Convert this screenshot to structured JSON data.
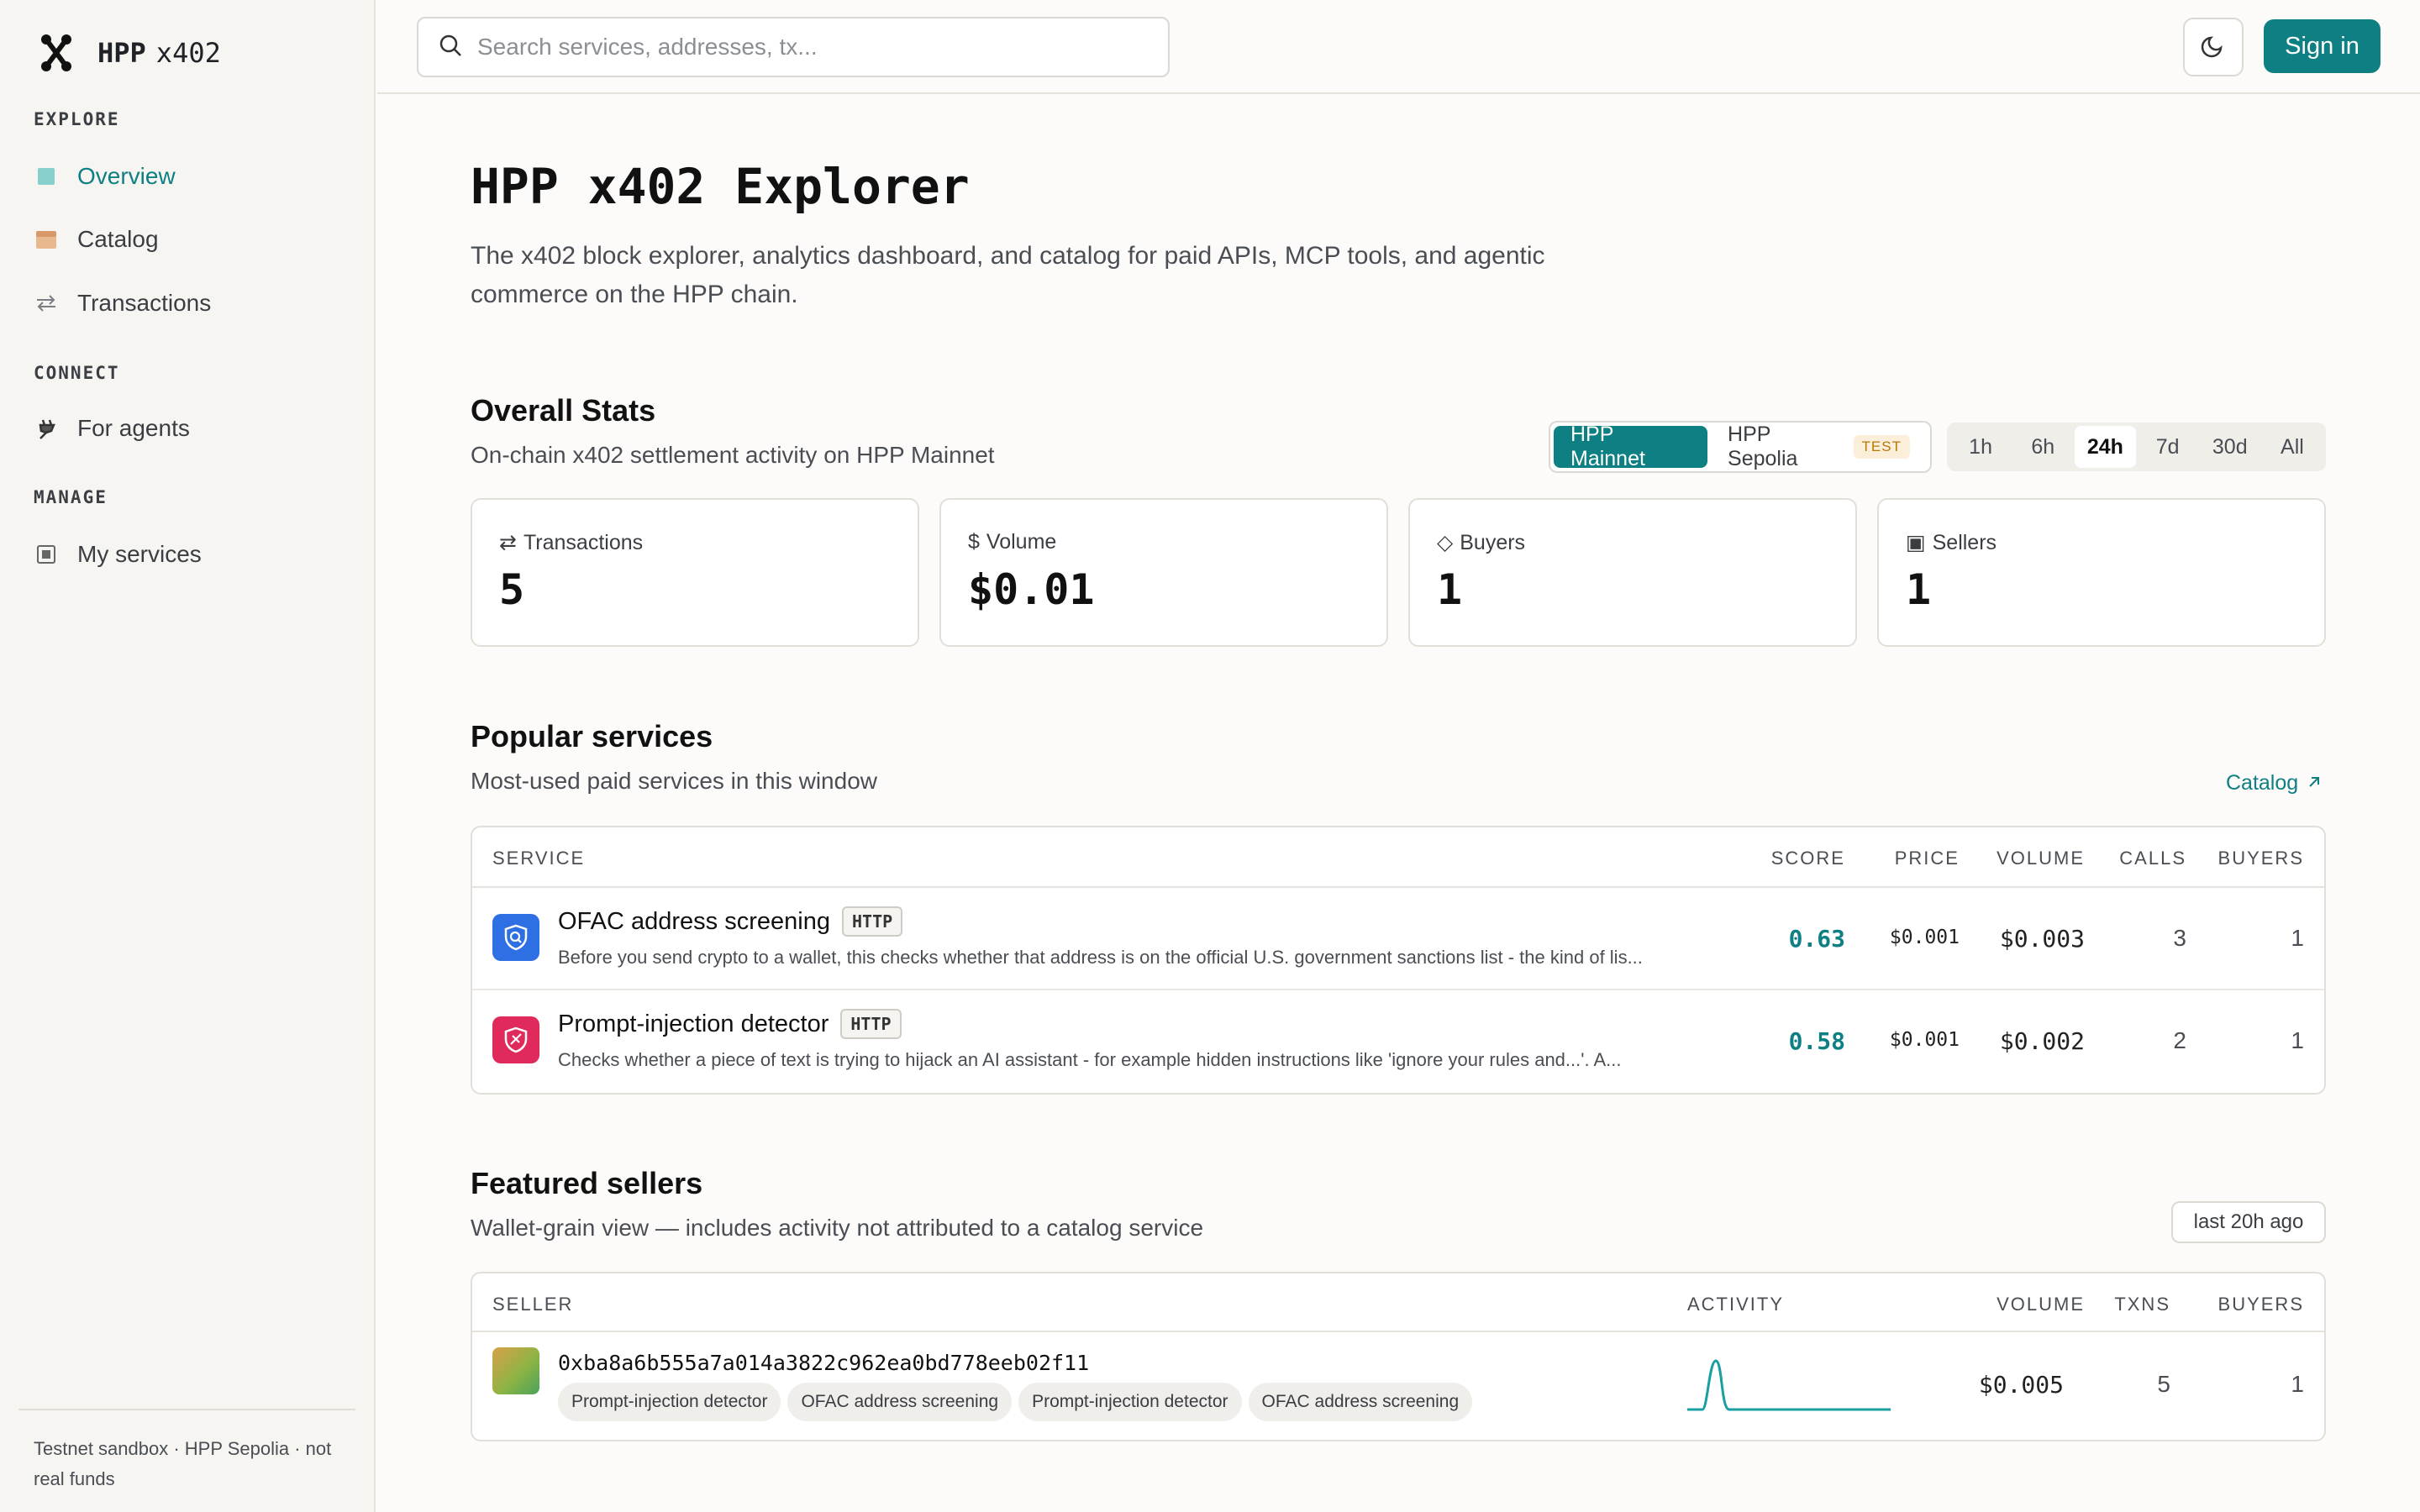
{
  "brand": {
    "name": "HPP",
    "suffix": "x402"
  },
  "sidebar": {
    "sections": [
      {
        "title": "EXPLORE"
      },
      {
        "title": "CONNECT"
      },
      {
        "title": "MANAGE"
      }
    ],
    "items": [
      {
        "label": "Overview",
        "icon": "overview-icon",
        "active": true
      },
      {
        "label": "Catalog",
        "icon": "catalog-icon"
      },
      {
        "label": "Transactions",
        "icon": "transactions-icon"
      },
      {
        "label": "For agents",
        "icon": "plug-icon"
      },
      {
        "label": "My services",
        "icon": "services-icon"
      }
    ],
    "footer": "Testnet sandbox · HPP Sepolia · not real funds"
  },
  "topbar": {
    "search_placeholder": "Search services, addresses, tx...",
    "signin_label": "Sign in"
  },
  "page": {
    "title": "HPP x402 Explorer",
    "description": "The x402 block explorer, analytics dashboard, and catalog for paid APIs, MCP tools, and agentic commerce on the HPP chain."
  },
  "stats": {
    "title": "Overall Stats",
    "subtitle": "On-chain x402 settlement activity on HPP Mainnet",
    "networks": [
      {
        "label": "HPP Mainnet",
        "active": true
      },
      {
        "label": "HPP Sepolia",
        "badge": "TEST"
      }
    ],
    "ranges": [
      "1h",
      "6h",
      "24h",
      "7d",
      "30d",
      "All"
    ],
    "active_range": "24h",
    "cards": [
      {
        "icon": "⇄",
        "label": "Transactions",
        "value": "5"
      },
      {
        "icon": "$",
        "label": "Volume",
        "value": "$0.01"
      },
      {
        "icon": "◇",
        "label": "Buyers",
        "value": "1"
      },
      {
        "icon": "▣",
        "label": "Sellers",
        "value": "1"
      }
    ]
  },
  "popular": {
    "title": "Popular services",
    "subtitle": "Most-used paid services in this window",
    "catalog_link": "Catalog",
    "columns": [
      "SERVICE",
      "SCORE",
      "PRICE",
      "VOLUME",
      "CALLS",
      "BUYERS"
    ],
    "rows": [
      {
        "name": "OFAC address screening",
        "badge": "HTTP",
        "icon": "shield-search-icon",
        "icon_color": "#2f6fe4",
        "description": "Before you send crypto to a wallet, this checks whether that address is on the official U.S. government sanctions list - the kind of lis...",
        "score": "0.63",
        "price": "$0.001",
        "volume": "$0.003",
        "calls": "3",
        "buyers": "1"
      },
      {
        "name": "Prompt-injection detector",
        "badge": "HTTP",
        "icon": "shield-alert-icon",
        "icon_color": "#e02a5c",
        "description": "Checks whether a piece of text is trying to hijack an AI assistant - for example hidden instructions like 'ignore your rules and...'. A...",
        "score": "0.58",
        "price": "$0.001",
        "volume": "$0.002",
        "calls": "2",
        "buyers": "1"
      }
    ]
  },
  "sellers": {
    "title": "Featured sellers",
    "subtitle": "Wallet-grain view — includes activity not attributed to a catalog service",
    "updated": "last 20h ago",
    "columns": [
      "SELLER",
      "ACTIVITY",
      "VOLUME",
      "TXNS",
      "BUYERS"
    ],
    "rows": [
      {
        "address": "0xba8a6b555a7a014a3822c962ea0bd778eeb02f11",
        "tags": [
          "Prompt-injection detector",
          "OFAC address screening",
          "Prompt-injection detector",
          "OFAC address screening"
        ],
        "volume": "$0.005",
        "txns": "5",
        "buyers": "1"
      }
    ]
  },
  "colors": {
    "accent": "#0e7f82",
    "background": "#fcfbf9",
    "sidebar": "#f6f5f2"
  }
}
